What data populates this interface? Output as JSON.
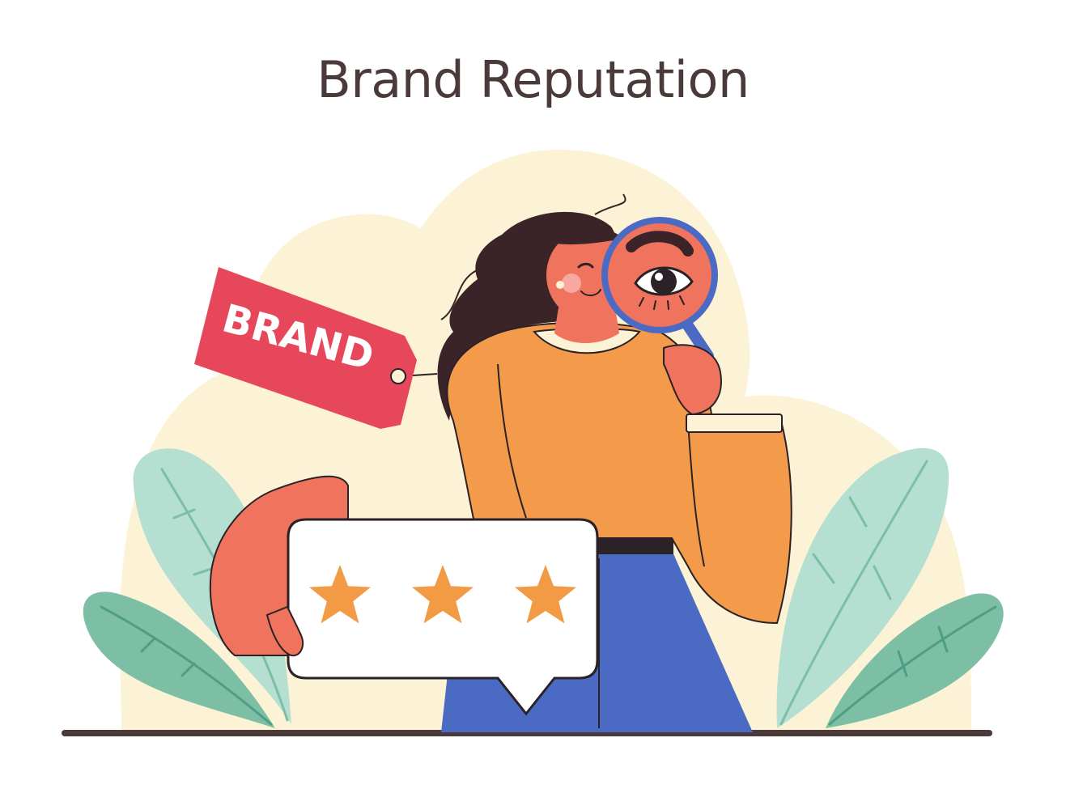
{
  "title": "Brand Reputation",
  "tag": {
    "label": "BRAND"
  },
  "rating": {
    "stars_filled": 3,
    "stars_total": 3
  },
  "icons": [
    "price-tag-icon",
    "star-icon",
    "magnifying-glass-icon",
    "speech-bubble-icon"
  ],
  "colors": {
    "title": "#4a3a39",
    "backdrop": "#fcf3d6",
    "leaf_light": "#b5dfd0",
    "leaf_dark": "#7dbfa5",
    "tag": "#e7475a",
    "sweater": "#f49a4b",
    "skirt": "#4a6ac3",
    "skin": "#f0735e",
    "hair": "#3a2428",
    "star": "#f29a44",
    "outline": "#2a2226",
    "ground": "#4a3a39"
  }
}
